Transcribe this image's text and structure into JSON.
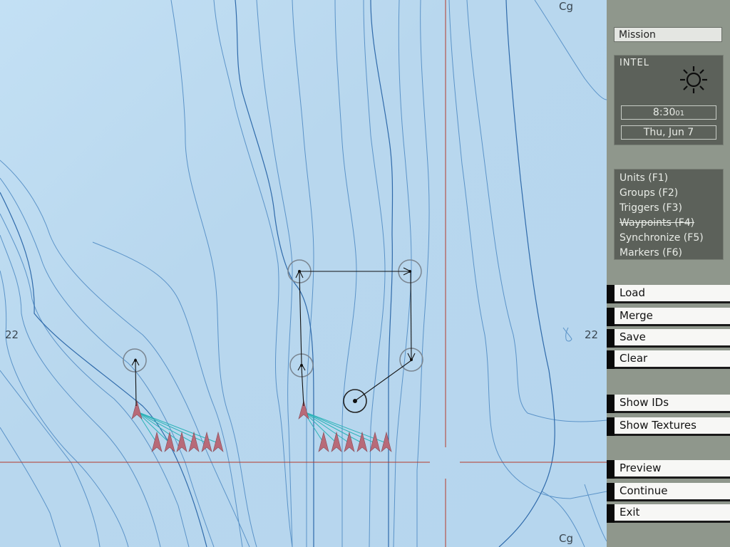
{
  "map": {
    "labels": {
      "cg_top": "Cg",
      "cg_bottom": "Cg",
      "grid_left": "22",
      "grid_right": "22"
    },
    "colors": {
      "contour": "#5b93c8",
      "contour_major": "#2f6aaa",
      "grid_line": "#b53a2a",
      "unit": "#b86a78",
      "link": "#2cb3b8",
      "waypoint_ring": "#7a8590",
      "route": "#111111"
    }
  },
  "panel": {
    "mission_label": "Mission",
    "intel": {
      "label": "INTEL",
      "weather_icon": "sun-icon",
      "time": "8:30",
      "seconds": "01",
      "date": "Thu, Jun 7"
    },
    "modes": [
      {
        "label": "Units (F1)"
      },
      {
        "label": "Groups (F2)"
      },
      {
        "label": "Triggers (F3)"
      },
      {
        "label": "Waypoints (F4)"
      },
      {
        "label": "Synchronize (F5)"
      },
      {
        "label": "Markers (F6)"
      }
    ],
    "active_mode": "Waypoints (F4)",
    "buttons": {
      "load": "Load",
      "merge": "Merge",
      "save": "Save",
      "clear": "Clear",
      "show_ids": "Show IDs",
      "show_textures": "Show Textures",
      "preview": "Preview",
      "continue": "Continue",
      "exit": "Exit"
    }
  }
}
